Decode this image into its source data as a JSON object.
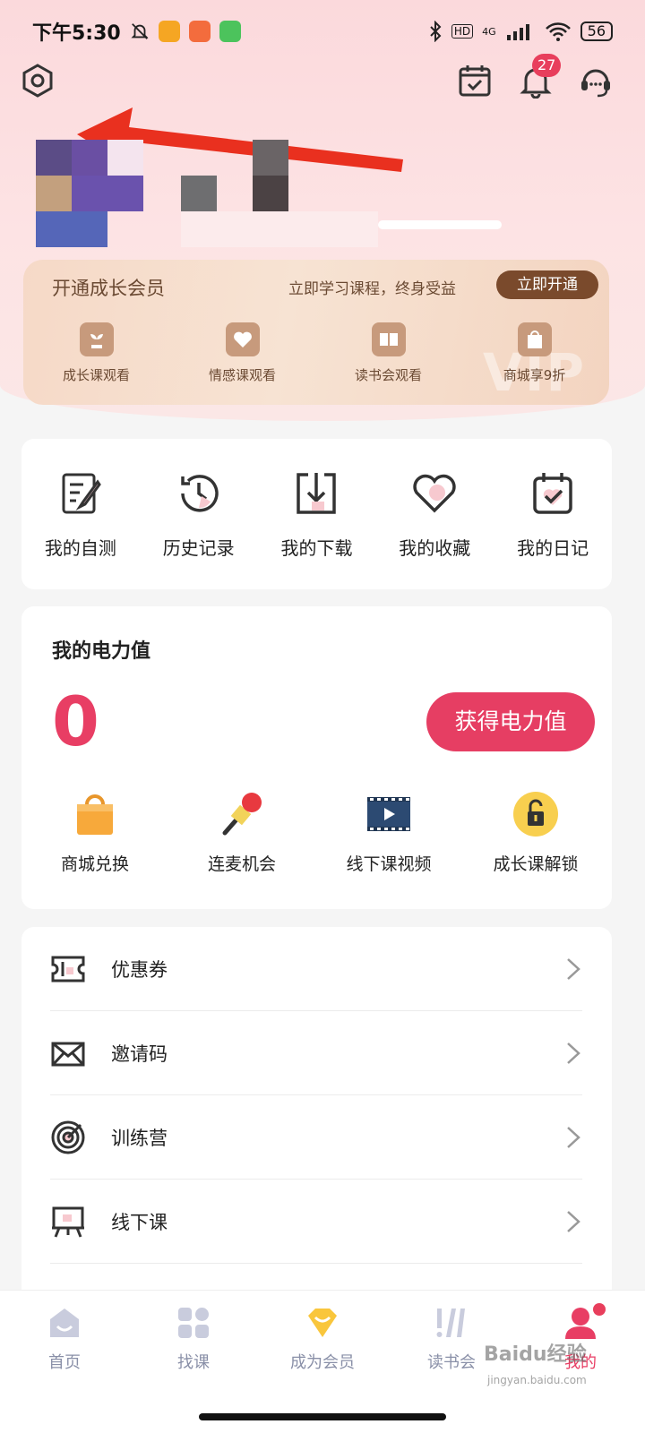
{
  "status_bar": {
    "time": "下午5:30",
    "network": "4G",
    "hd": "HD",
    "battery": "56"
  },
  "header": {
    "notification_count": "27"
  },
  "vip": {
    "title": "开通成长会员",
    "subtitle": "立即学习课程，终身受益",
    "button": "立即开通",
    "watermark": "VIP",
    "benefits": [
      {
        "label": "成长课观看",
        "icon": "sprout-icon"
      },
      {
        "label": "情感课观看",
        "icon": "heart-icon"
      },
      {
        "label": "读书会观看",
        "icon": "book-icon"
      },
      {
        "label": "商城享9折",
        "icon": "shopping-bag-icon"
      }
    ]
  },
  "quick": {
    "items": [
      {
        "label": "我的自测",
        "icon": "test-icon"
      },
      {
        "label": "历史记录",
        "icon": "history-icon"
      },
      {
        "label": "我的下载",
        "icon": "download-icon"
      },
      {
        "label": "我的收藏",
        "icon": "favorite-icon"
      },
      {
        "label": "我的日记",
        "icon": "diary-icon"
      }
    ]
  },
  "power": {
    "title": "我的电力值",
    "value": "0",
    "button": "获得电力值",
    "items": [
      {
        "label": "商城兑换",
        "icon": "shopping-bag-icon"
      },
      {
        "label": "连麦机会",
        "icon": "microphone-icon"
      },
      {
        "label": "线下课视频",
        "icon": "video-icon"
      },
      {
        "label": "成长课解锁",
        "icon": "unlock-icon"
      }
    ]
  },
  "menu": {
    "items": [
      {
        "label": "优惠券",
        "icon": "coupon-icon"
      },
      {
        "label": "邀请码",
        "icon": "envelope-icon"
      },
      {
        "label": "训练营",
        "icon": "target-icon"
      },
      {
        "label": "线下课",
        "icon": "easel-icon"
      }
    ]
  },
  "tabbar": {
    "items": [
      {
        "label": "首页",
        "icon": "home-icon",
        "active": false
      },
      {
        "label": "找课",
        "icon": "grid-icon",
        "active": false
      },
      {
        "label": "成为会员",
        "icon": "vip-badge-icon",
        "active": false
      },
      {
        "label": "读书会",
        "icon": "reading-club-icon",
        "active": false
      },
      {
        "label": "我的",
        "icon": "profile-icon",
        "active": true
      }
    ]
  },
  "watermark": {
    "brand": "Baidu经验",
    "url": "jingyan.baidu.com"
  },
  "colors": {
    "accent": "#e83e64",
    "vip_brown": "#7a4a2c"
  }
}
